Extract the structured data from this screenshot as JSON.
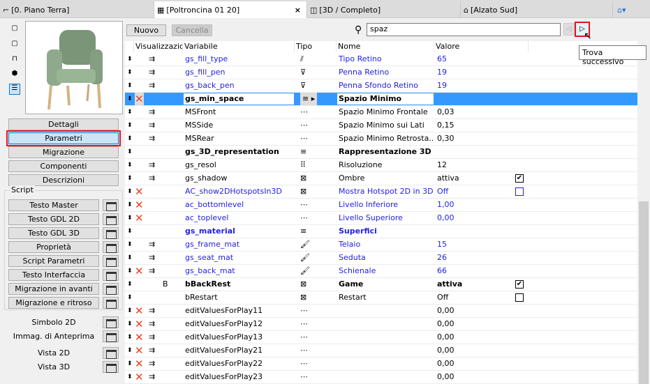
{
  "tabs": [
    {
      "label": "[0. Piano Terra]",
      "icon": "floor-plan-icon"
    },
    {
      "label": "[Poltroncina 01 20]",
      "icon": "object-editor-icon",
      "active": true
    },
    {
      "label": "[3D / Completo]",
      "icon": "3d-window-icon"
    },
    {
      "label": "[Alzato Sud]",
      "icon": "elevation-icon"
    }
  ],
  "left_nav": [
    "Dettagli",
    "Parametri",
    "Migrazione",
    "Componenti",
    "Descrizioni"
  ],
  "script_group": {
    "title": "Script",
    "items": [
      "Testo Master",
      "Testo GDL 2D",
      "Testo GDL 3D",
      "Proprietà",
      "Script Parametri",
      "Testo Interfaccia",
      "Migrazione in avanti",
      "Migrazione e ritroso"
    ]
  },
  "views": [
    "Simbolo 2D",
    "Immag. di Anteprima",
    "Vista 2D",
    "Vista 3D"
  ],
  "toolbar": {
    "new_label": "Nuovo",
    "delete_label": "Cancella",
    "search_value": "spaz",
    "tooltip": "Trova successivo"
  },
  "columns": [
    "Visualizzazioni",
    "Variabile",
    "Tipo",
    "Nome",
    "Valore"
  ],
  "accent": "#3399ff",
  "rows": [
    {
      "var": "gs_fill_type",
      "type": "fill-pattern",
      "name": "Tipo Retino",
      "value": "65",
      "blue": true,
      "vis": true
    },
    {
      "var": "gs_fill_pen",
      "type": "pen",
      "name": "Penna Retino",
      "value": "19",
      "blue": true,
      "vis": true
    },
    {
      "var": "gs_back_pen",
      "type": "pen",
      "name": "Penna Sfondo Retino",
      "value": "19",
      "blue": true,
      "vis": true
    },
    {
      "var": "gs_min_space",
      "type": "title",
      "name": "Spazio Minimo",
      "value": "",
      "bold": true,
      "x": true,
      "selected": true
    },
    {
      "var": "MSFront",
      "type": "length",
      "name": "Spazio Minimo Frontale",
      "value": "0,03",
      "vis": true
    },
    {
      "var": "MSSide",
      "type": "length",
      "name": "Spazio Minimo sui Lati",
      "value": "0,15",
      "vis": true
    },
    {
      "var": "MSRear",
      "type": "length",
      "name": "Spazio Minimo Retrosta...",
      "value": "0,30",
      "vis": true
    },
    {
      "var": "gs_3D_representation",
      "type": "title",
      "name": "Rappresentazione 3D",
      "value": "",
      "bold": true
    },
    {
      "var": "gs_resol",
      "type": "integer",
      "name": "Risoluzione",
      "value": "12",
      "vis": true
    },
    {
      "var": "gs_shadow",
      "type": "boolean",
      "name": "Ombre",
      "value": "attiva",
      "vis": true,
      "check": true
    },
    {
      "var": "AC_show2DHotspotsIn3D",
      "type": "boolean",
      "name": "Mostra Hotspot 2D in 3D",
      "value": "Off",
      "blue": true,
      "x": true,
      "check": false
    },
    {
      "var": "ac_bottomlevel",
      "type": "length",
      "name": "Livello Inferiore",
      "value": "1,00",
      "blue": true,
      "x": true
    },
    {
      "var": "ac_toplevel",
      "type": "length",
      "name": "Livello Superiore",
      "value": "0,00",
      "blue": true,
      "x": true
    },
    {
      "var": "gs_material",
      "type": "title",
      "name": "Superfici",
      "value": "",
      "blue": true,
      "bold": true
    },
    {
      "var": "gs_frame_mat",
      "type": "material",
      "name": "Telaio",
      "value": "15",
      "blue": true,
      "vis": true
    },
    {
      "var": "gs_seat_mat",
      "type": "material",
      "name": "Seduta",
      "value": "26",
      "blue": true,
      "vis": true
    },
    {
      "var": "gs_back_mat",
      "type": "material",
      "name": "Schienale",
      "value": "66",
      "blue": true,
      "vis": true,
      "x": true
    },
    {
      "var": "bBackRest",
      "type": "boolean",
      "name": "Game",
      "value": "attiva",
      "bold": true,
      "flag": "B",
      "check": true
    },
    {
      "var": "bRestart",
      "type": "boolean",
      "name": "Restart",
      "value": "Off",
      "check": false
    },
    {
      "var": "editValuesForPlay11",
      "type": "length",
      "name": "",
      "value": "0,00",
      "x": true,
      "vis": true
    },
    {
      "var": "editValuesForPlay12",
      "type": "length",
      "name": "",
      "value": "0,00",
      "x": true,
      "vis": true
    },
    {
      "var": "editValuesForPlay13",
      "type": "length",
      "name": "",
      "value": "0,00",
      "x": true,
      "vis": true
    },
    {
      "var": "editValuesForPlay21",
      "type": "length",
      "name": "",
      "value": "0,00",
      "x": true,
      "vis": true
    },
    {
      "var": "editValuesForPlay22",
      "type": "length",
      "name": "",
      "value": "0,00",
      "x": true,
      "vis": true
    },
    {
      "var": "editValuesForPlay23",
      "type": "length",
      "name": "",
      "value": "0,00",
      "x": true,
      "vis": true
    }
  ]
}
